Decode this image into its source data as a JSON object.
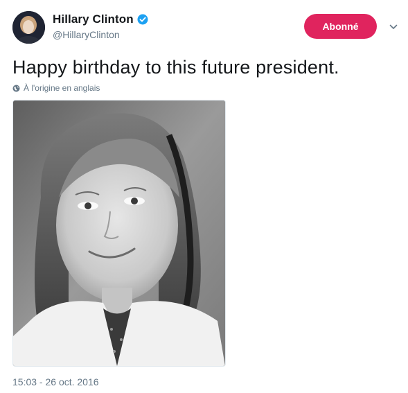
{
  "author": {
    "display_name": "Hillary Clinton",
    "handle": "@HillaryClinton",
    "verified": true,
    "avatar_icon": "profile-photo"
  },
  "follow_button": {
    "label": "Abonné",
    "color": "#e0245e"
  },
  "menu_icon": "chevron-down-icon",
  "tweet": {
    "text": "Happy birthday to this future president.",
    "translation_note": "À l'origine en anglais",
    "translation_icon": "globe-icon",
    "media_icon": "childhood-portrait-photo",
    "timestamp": "15:03 - 26 oct. 2016"
  },
  "colors": {
    "text": "#14171a",
    "secondary": "#657786",
    "verified_blue": "#1da1f2",
    "follow_red": "#e0245e"
  }
}
